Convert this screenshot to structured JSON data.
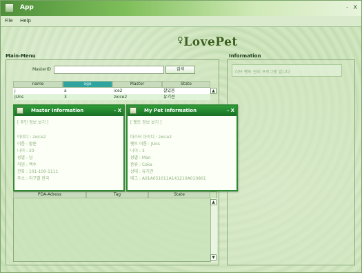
{
  "window": {
    "title": "App",
    "controls": [
      "-",
      "X"
    ]
  },
  "menu": {
    "items": [
      "File",
      "Help"
    ]
  },
  "brand": {
    "text": "LovePet"
  },
  "main_menu": {
    "title": "Main-Menu",
    "master_id_label": "MasterID",
    "master_id_value": "",
    "search_button": "검색",
    "columns": [
      "name",
      "age",
      "Master",
      "State"
    ],
    "sorted_column": "age",
    "rows": [
      [
        "j",
        "a",
        "ice2",
        "잘있음"
      ],
      [
        "JUns",
        "3",
        "zxice2",
        "유기견"
      ]
    ],
    "lower_columns": [
      "PDA-Adress",
      "Tag",
      "State"
    ]
  },
  "information": {
    "title": "Information",
    "text": "러브 펫토 관리 프로그램 입니다"
  },
  "master_window": {
    "title": "Master Information",
    "controls": [
      "-",
      "X"
    ],
    "header": "[ 주인 정보 보기 ]",
    "lines": [
      "아이디 : zxice2",
      "이름 : 황준",
      "나이 : 20",
      "성별 : 남",
      "직업 : 백수",
      "전화 : 101-100-1111",
      "주소 : 지구별 한국"
    ]
  },
  "pet_window": {
    "title": "My Pet Information",
    "controls": [
      "-",
      "X"
    ],
    "header": "[ 펫트 정보 보기 ]",
    "lines": [
      "마스터 아이디 : zxice2",
      "펫트 이름 : JUns",
      "나이 : 3",
      "성별 : Man",
      "종류 : Coka",
      "상태 : 유기견",
      "태그 : A01A051011A141210A010801"
    ]
  },
  "colors": {
    "titlebar_start": "#4e8f3a",
    "internal_title": "#2f9d3a",
    "sorted_header": "#2ea3a0",
    "background": "#cde3bd"
  }
}
